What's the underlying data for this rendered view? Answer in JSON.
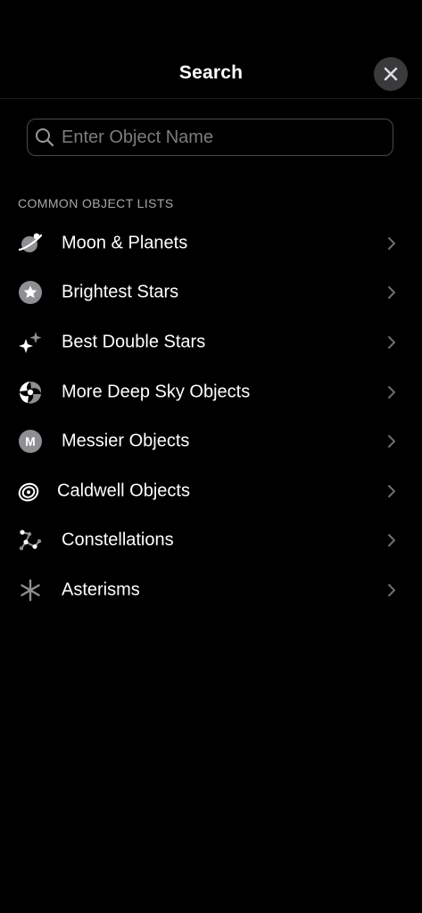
{
  "header": {
    "title": "Search",
    "close_icon": "close-icon"
  },
  "search": {
    "placeholder": "Enter Object Name",
    "value": "",
    "icon": "search-icon"
  },
  "section": {
    "title": "COMMON OBJECT LISTS"
  },
  "items": [
    {
      "label": "Moon & Planets",
      "icon": "planet-icon"
    },
    {
      "label": "Brightest Stars",
      "icon": "star-badge-icon"
    },
    {
      "label": "Best Double Stars",
      "icon": "sparkle-icon"
    },
    {
      "label": "More Deep Sky Objects",
      "icon": "galaxy-icon"
    },
    {
      "label": "Messier Objects",
      "icon": "messier-icon",
      "badge_text": "M"
    },
    {
      "label": "Caldwell Objects",
      "icon": "spiral-icon"
    },
    {
      "label": "Constellations",
      "icon": "constellation-icon"
    },
    {
      "label": "Asterisms",
      "icon": "asterisk-icon"
    }
  ],
  "colors": {
    "background": "#000000",
    "icon_gray": "#8e8e93",
    "chevron": "#6e6e73",
    "close_bg": "#3a3a3c"
  }
}
